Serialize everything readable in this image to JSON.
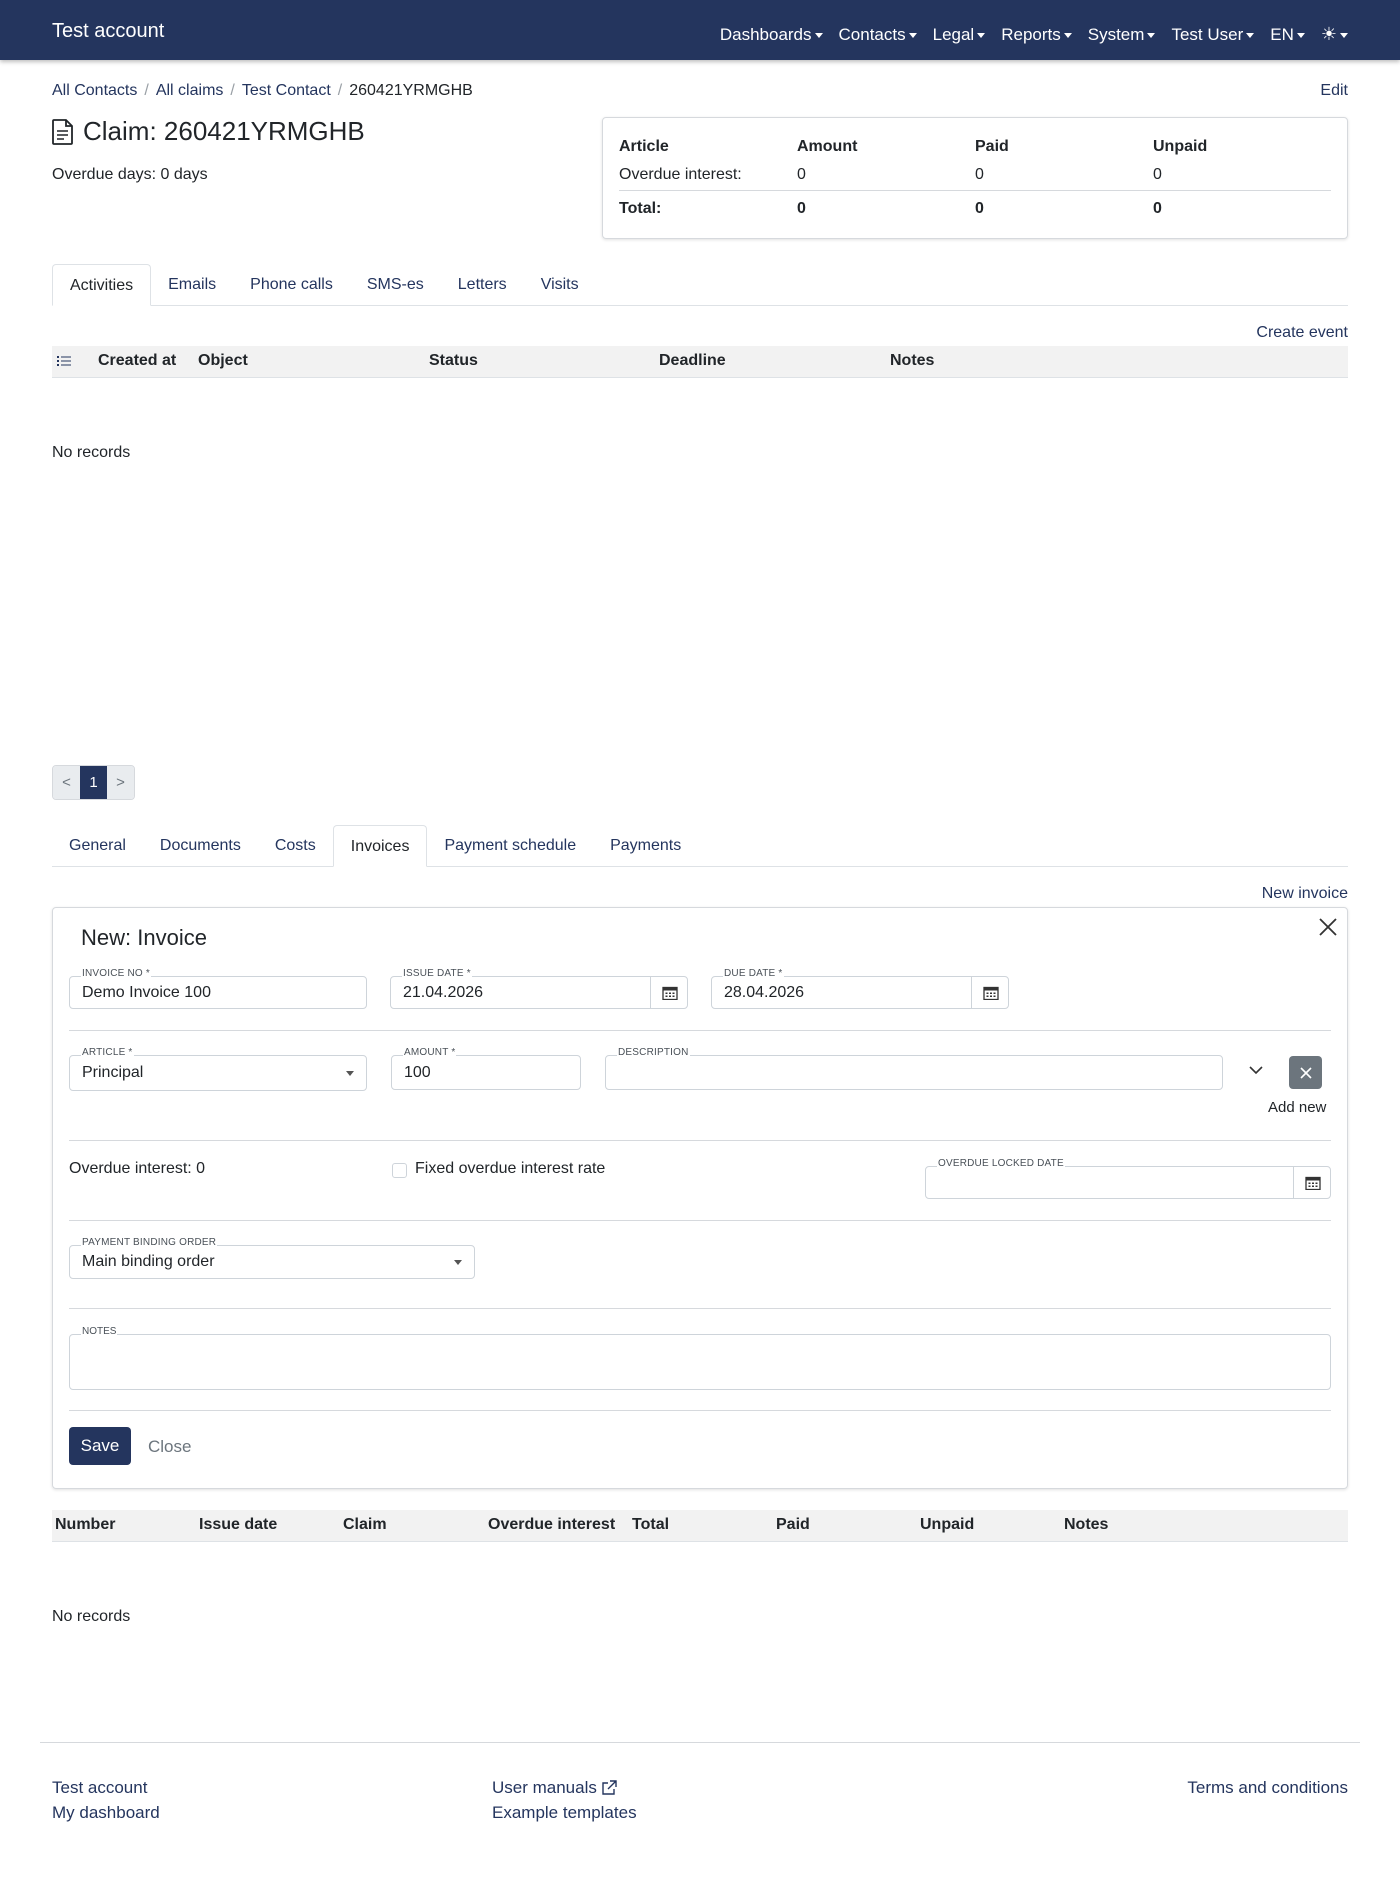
{
  "navbar": {
    "brand": "Test account",
    "items": [
      "Dashboards",
      "Contacts",
      "Legal",
      "Reports",
      "System",
      "Test User",
      "EN"
    ],
    "theme_icon": "sun-icon"
  },
  "breadcrumb": {
    "items": [
      "All Contacts",
      "All claims",
      "Test Contact"
    ],
    "current": "260421YRMGHB",
    "edit_label": "Edit"
  },
  "claim": {
    "title": "Claim: 260421YRMGHB",
    "overdue_days": "Overdue days: 0 days"
  },
  "summary": {
    "headers": [
      "Article",
      "Amount",
      "Paid",
      "Unpaid"
    ],
    "rows": [
      [
        "Overdue interest:",
        "0",
        "0",
        "0"
      ]
    ],
    "total": [
      "Total:",
      "0",
      "0",
      "0"
    ]
  },
  "activity_tabs": [
    "Activities",
    "Emails",
    "Phone calls",
    "SMS-es",
    "Letters",
    "Visits"
  ],
  "activities": {
    "create_label": "Create event",
    "columns": [
      "Created at",
      "Object",
      "Status",
      "Deadline",
      "Notes"
    ],
    "empty": "No records"
  },
  "pagination": {
    "prev": "<",
    "page": "1",
    "next": ">"
  },
  "detail_tabs": [
    "General",
    "Documents",
    "Costs",
    "Invoices",
    "Payment schedule",
    "Payments"
  ],
  "invoices": {
    "new_label": "New invoice",
    "columns": [
      "Number",
      "Issue date",
      "Claim",
      "Overdue interest",
      "Total",
      "Paid",
      "Unpaid",
      "Notes"
    ],
    "empty": "No records"
  },
  "invoice_form": {
    "title": "New: Invoice",
    "invoice_no": {
      "label": "INVOICE NO *",
      "value": "Demo Invoice 100"
    },
    "issue_date": {
      "label": "ISSUE DATE *",
      "value": "21.04.2026"
    },
    "due_date": {
      "label": "DUE DATE *",
      "value": "28.04.2026"
    },
    "article": {
      "label": "ARTICLE *",
      "value": "Principal"
    },
    "amount": {
      "label": "AMOUNT *",
      "value": "100"
    },
    "description": {
      "label": "DESCRIPTION",
      "value": ""
    },
    "add_new": "Add new",
    "overdue_interest": "Overdue interest: 0",
    "fixed_rate_label": "Fixed overdue interest rate",
    "fixed_rate_checked": false,
    "overdue_locked_date": {
      "label": "OVERDUE LOCKED DATE",
      "value": ""
    },
    "payment_binding_order": {
      "label": "PAYMENT BINDING ORDER",
      "value": "Main binding order"
    },
    "notes": {
      "label": "NOTES",
      "value": ""
    },
    "save_label": "Save",
    "close_label": "Close"
  },
  "footer": {
    "col1": [
      "Test account",
      "My dashboard"
    ],
    "col2": [
      "User manuals",
      "Example templates"
    ],
    "col3": [
      "Terms and conditions"
    ]
  },
  "colors": {
    "primary": "#24355e",
    "secondary": "#6c757d",
    "header_bg": "#f2f2f2"
  }
}
